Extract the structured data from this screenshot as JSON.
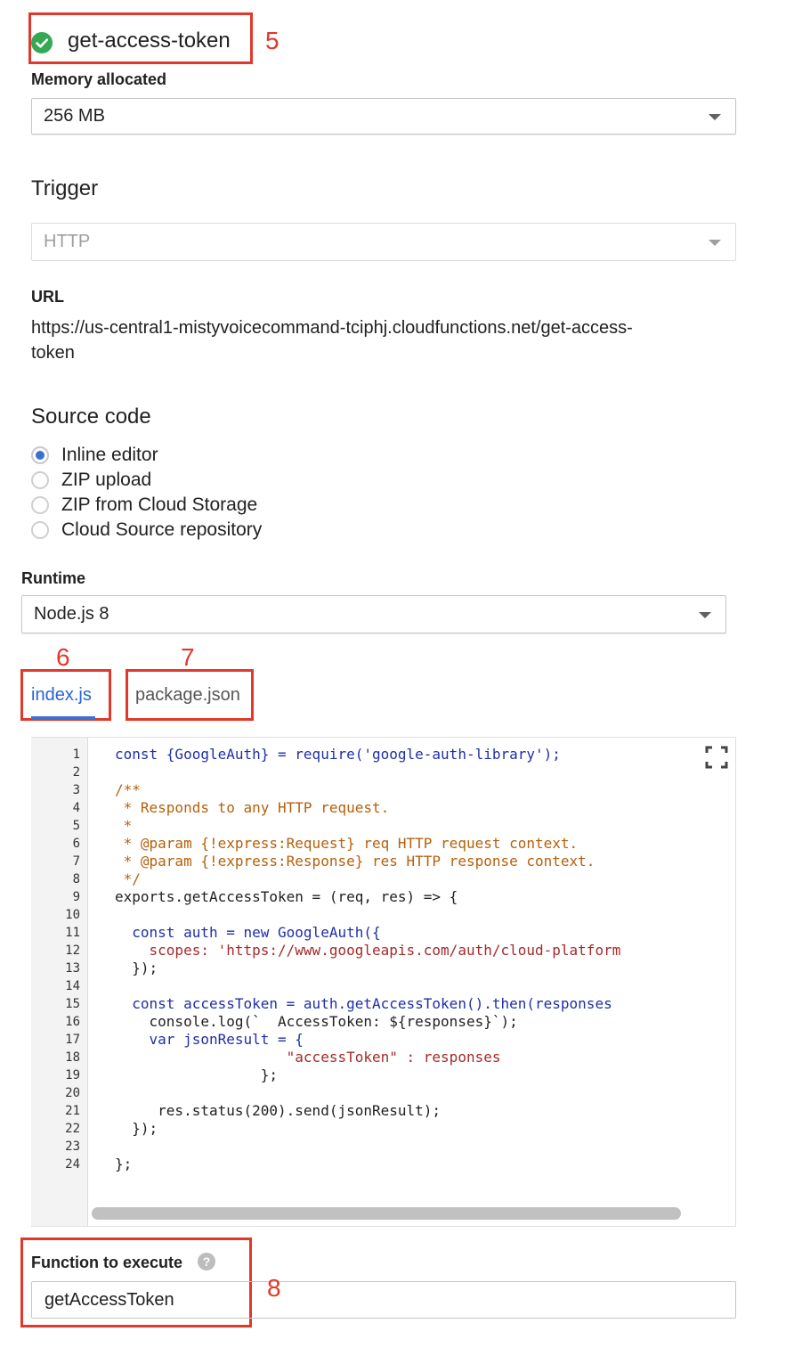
{
  "function": {
    "name": "get-access-token",
    "status_icon": "check-circle-icon",
    "status_color": "#34a853"
  },
  "memory": {
    "label": "Memory allocated",
    "value": "256 MB"
  },
  "trigger": {
    "title": "Trigger",
    "value": "HTTP"
  },
  "url": {
    "label": "URL",
    "line1": "https://us-central1-mistyvoicecommand-tciphj.cloudfunctions.net/get-access-",
    "line2": "token"
  },
  "source_code": {
    "title": "Source code",
    "options": [
      {
        "label": "Inline editor",
        "checked": true
      },
      {
        "label": "ZIP upload",
        "checked": false
      },
      {
        "label": "ZIP from Cloud Storage",
        "checked": false
      },
      {
        "label": "Cloud Source repository",
        "checked": false
      }
    ]
  },
  "runtime": {
    "label": "Runtime",
    "value": "Node.js 8"
  },
  "tabs": [
    {
      "label": "index.js",
      "active": true
    },
    {
      "label": "package.json",
      "active": false
    }
  ],
  "editor": {
    "line_numbers": [
      "1",
      "2",
      "3",
      "4",
      "5",
      "6",
      "7",
      "8",
      "9",
      "10",
      "11",
      "12",
      "13",
      "14",
      "15",
      "16",
      "17",
      "18",
      "19",
      "20",
      "21",
      "22",
      "23",
      "24"
    ],
    "lines": [
      "const {GoogleAuth} = require('google-auth-library');",
      "",
      "/**",
      " * Responds to any HTTP request.",
      " *",
      " * @param {!express:Request} req HTTP request context.",
      " * @param {!express:Response} res HTTP response context.",
      " */",
      "exports.getAccessToken = (req, res) => {",
      "",
      "  const auth = new GoogleAuth({",
      "    scopes: 'https://www.googleapis.com/auth/cloud-platform",
      "  });",
      "",
      "  const accessToken = auth.getAccessToken().then(responses",
      "    console.log(`  AccessToken: ${responses}`);",
      "    var jsonResult = {",
      "                    \"accessToken\" : responses",
      "                 };",
      "",
      "     res.status(200).send(jsonResult);",
      "  });",
      "",
      "};"
    ]
  },
  "function_to_execute": {
    "label": "Function to execute",
    "help_icon": "help-icon",
    "value": "getAccessToken"
  },
  "callouts": {
    "c5": "5",
    "c6": "6",
    "c7": "7",
    "c8": "8",
    "color": "#e0382b"
  }
}
